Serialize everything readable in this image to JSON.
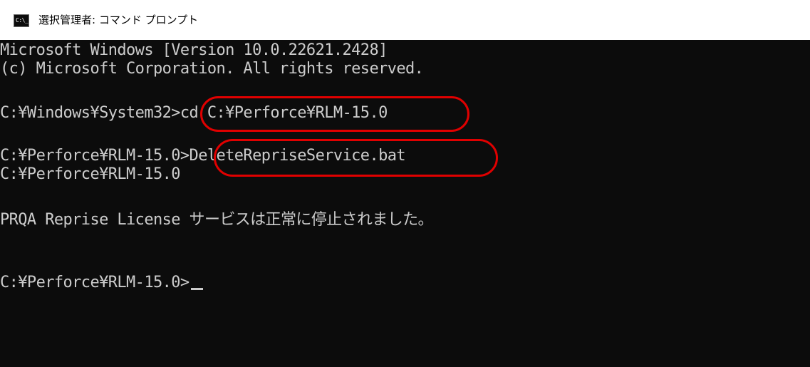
{
  "window": {
    "title": "選択管理者: コマンド プロンプト",
    "icon": "cmd-icon",
    "icon_text": "C:\\_"
  },
  "console": {
    "lines": [
      "Microsoft Windows [Version 10.0.22621.2428]",
      "(c) Microsoft Corporation. All rights reserved.",
      "C:¥Windows¥System32>cd C:¥Perforce¥RLM-15.0",
      "C:¥Perforce¥RLM-15.0>DeleteRepriseService.bat",
      "C:¥Perforce¥RLM-15.0",
      "PRQA Reprise License サービスは正常に停止されました。",
      "C:¥Perforce¥RLM-15.0>"
    ]
  },
  "colors": {
    "console_bg": "#0c0c0c",
    "console_text": "#cccccc",
    "highlight": "#e00000"
  }
}
